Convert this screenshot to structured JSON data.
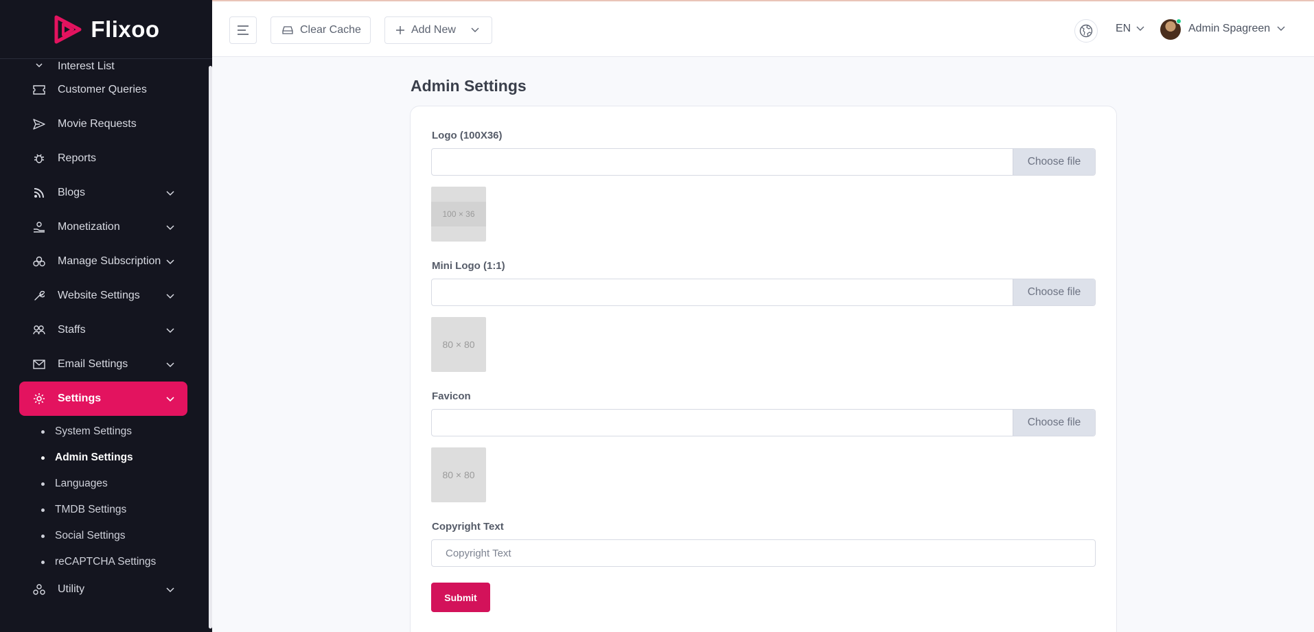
{
  "brand": {
    "name": "Flixoo",
    "accent": "#e3135f"
  },
  "sidebar": {
    "partial_item": "Interest List",
    "items": [
      {
        "label": "Customer Queries",
        "icon": "ticket-icon",
        "has_children": false
      },
      {
        "label": "Movie Requests",
        "icon": "send-icon",
        "has_children": false
      },
      {
        "label": "Reports",
        "icon": "bug-icon",
        "has_children": false
      },
      {
        "label": "Blogs",
        "icon": "rss-icon",
        "has_children": true
      },
      {
        "label": "Monetization",
        "icon": "hand-coin-icon",
        "has_children": true
      },
      {
        "label": "Manage Subscription",
        "icon": "subscription-icon",
        "has_children": true
      },
      {
        "label": "Website Settings",
        "icon": "wrench-icon",
        "has_children": true
      },
      {
        "label": "Staffs",
        "icon": "users-icon",
        "has_children": true
      },
      {
        "label": "Email Settings",
        "icon": "mail-icon",
        "has_children": true
      }
    ],
    "active": {
      "label": "Settings",
      "icon": "gear-icon"
    },
    "subitems": [
      {
        "label": "System Settings",
        "current": false
      },
      {
        "label": "Admin Settings",
        "current": true
      },
      {
        "label": "Languages",
        "current": false
      },
      {
        "label": "TMDB Settings",
        "current": false
      },
      {
        "label": "Social Settings",
        "current": false
      },
      {
        "label": "reCAPTCHA Settings",
        "current": false
      }
    ],
    "last": {
      "label": "Utility",
      "icon": "utility-icon"
    }
  },
  "topbar": {
    "clear_cache": "Clear Cache",
    "add_new": "Add New",
    "language": "EN",
    "user_name": "Admin Spagreen"
  },
  "main": {
    "title": "Admin Settings",
    "logo": {
      "label": "Logo (100X36)",
      "button": "Choose file",
      "preview": "100 × 36"
    },
    "mini_logo": {
      "label": "Mini Logo (1:1)",
      "button": "Choose file",
      "preview": "80 × 80"
    },
    "favicon": {
      "label": "Favicon",
      "button": "Choose file",
      "preview": "80 × 80"
    },
    "copyright": {
      "label": "Copyright Text",
      "placeholder": "Copyright Text",
      "value": ""
    },
    "submit": "Submit"
  }
}
